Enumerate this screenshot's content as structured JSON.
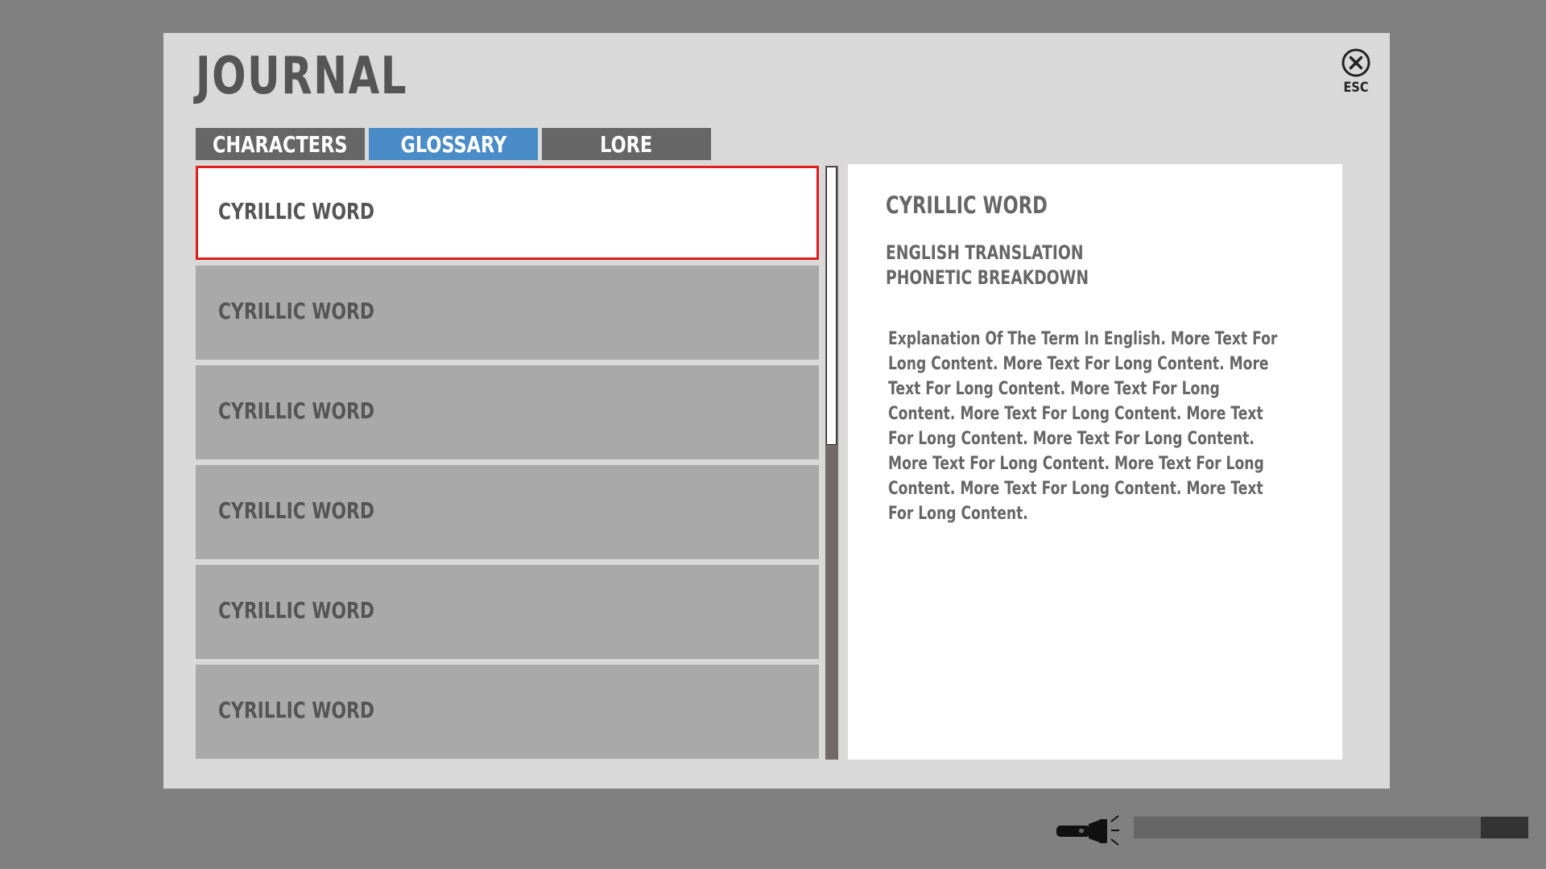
{
  "journal": {
    "title": "JOURNAL",
    "close_label": "ESC",
    "close_icon": "close-circle-icon"
  },
  "tabs": [
    {
      "label": "CHARACTERS",
      "active": false
    },
    {
      "label": "GLOSSARY",
      "active": true
    },
    {
      "label": "LORE",
      "active": false
    }
  ],
  "entries": [
    {
      "label": "CYRILLIC WORD",
      "selected": true
    },
    {
      "label": "CYRILLIC WORD",
      "selected": false
    },
    {
      "label": "CYRILLIC WORD",
      "selected": false
    },
    {
      "label": "CYRILLIC WORD",
      "selected": false
    },
    {
      "label": "CYRILLIC WORD",
      "selected": false
    },
    {
      "label": "CYRILLIC WORD",
      "selected": false
    }
  ],
  "detail": {
    "word": "CYRILLIC WORD",
    "translation": "ENGLISH TRANSLATION",
    "phonetic": "PHONETIC BREAKDOWN",
    "description": "Explanation Of The Term In English. More Text For Long Content. More Text For Long Content. More Text For Long Content. More Text For Long Content. More Text For Long Content. More Text For Long Content. More Text For Long Content. More Text For Long Content. More Text For Long Content. More Text For Long Content. More Text For Long Content."
  },
  "hud": {
    "flashlight_icon": "flashlight-icon",
    "battery_level": 0.12
  },
  "colors": {
    "background": "#808080",
    "panel": "#d9d9d9",
    "tab_inactive": "#666666",
    "tab_active": "#4a8cc7",
    "entry": "#a9a9a9",
    "selected_border": "#e01e1e",
    "text": "#555555"
  }
}
